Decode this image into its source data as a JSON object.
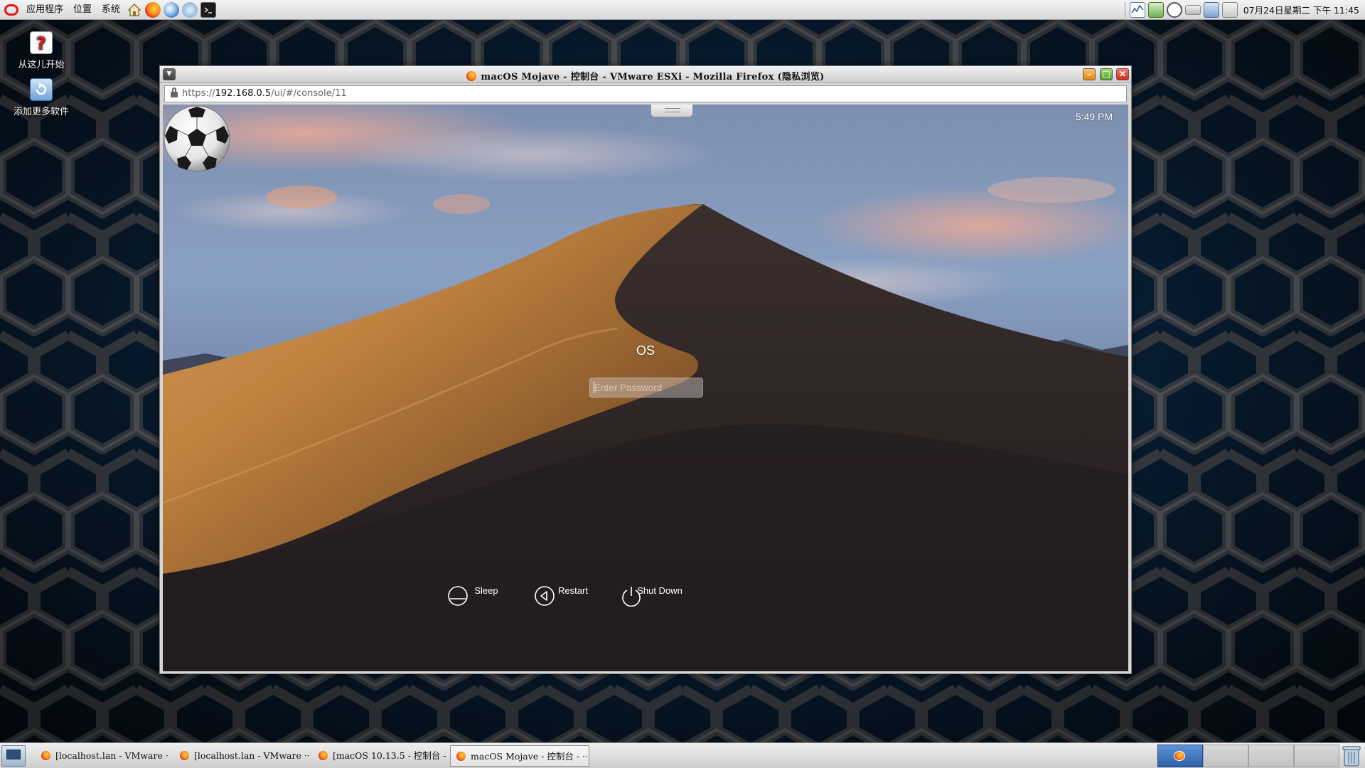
{
  "top_panel": {
    "menus": [
      "应用程序",
      "位置",
      "系统"
    ],
    "clock": "07月24日星期二 下午 11:45"
  },
  "desktop": {
    "icons": [
      {
        "label": "从这儿开始",
        "icon": "help-icon"
      },
      {
        "label": "添加更多软件",
        "icon": "add-software-icon"
      }
    ]
  },
  "window": {
    "title": "macOS Mojave - 控制台 - VMware ESXi - Mozilla Firefox (隐私浏览)",
    "url_scheme": "https://",
    "url_host": "192.168.0.5",
    "url_path": "/ui/#/console/11"
  },
  "console": {
    "time": "5:49 PM",
    "username": "OS",
    "password_placeholder": "Enter Password",
    "buttons": [
      {
        "label": "Sleep",
        "icon": "sleep-icon"
      },
      {
        "label": "Restart",
        "icon": "restart-icon"
      },
      {
        "label": "Shut Down",
        "icon": "shutdown-icon"
      }
    ]
  },
  "taskbar": {
    "tasks": [
      {
        "label": "[localhost.lan - VMware ···"
      },
      {
        "label": "[localhost.lan - VMware ···"
      },
      {
        "label": "[macOS 10.13.5 - 控制台 - ···"
      },
      {
        "label": "macOS Mojave - 控制台 - ···",
        "active": true
      }
    ],
    "workspaces": 4
  },
  "colors": {
    "desktop_bg": "#0a2744",
    "panel_bg": "#e3e3e3",
    "close_button": "#d12a1a",
    "maximize_button": "#4f9d28",
    "minimize_button": "#e6850d",
    "workspace_active": "#2d62a8"
  }
}
